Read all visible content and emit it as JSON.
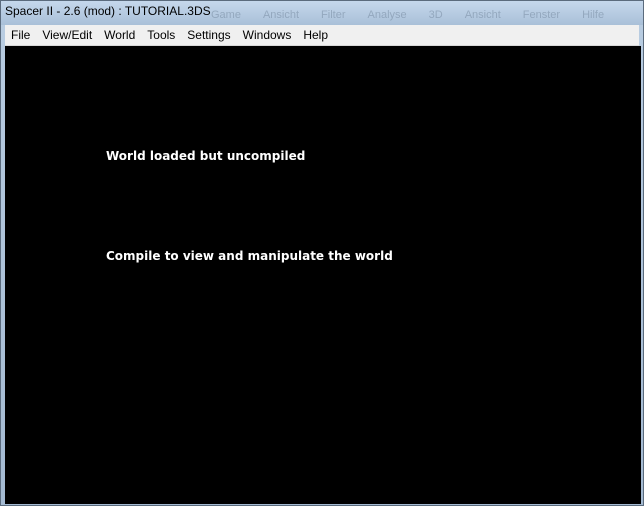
{
  "window": {
    "title": "Spacer II - 2.6 (mod) : TUTORIAL.3DS"
  },
  "background_menu": [
    "Game",
    "Ansicht",
    "Filter",
    "Analyse",
    "3D",
    "Ansicht",
    "Fenster",
    "Hilfe"
  ],
  "menu": {
    "items": [
      {
        "label": "File"
      },
      {
        "label": "View/Edit"
      },
      {
        "label": "World"
      },
      {
        "label": "Tools"
      },
      {
        "label": "Settings"
      },
      {
        "label": "Windows"
      },
      {
        "label": "Help"
      }
    ]
  },
  "viewport": {
    "message_status": "World loaded but uncompiled",
    "message_hint": "Compile to view and manipulate the world",
    "background_color": "#000000",
    "text_color": "#ffffff"
  }
}
